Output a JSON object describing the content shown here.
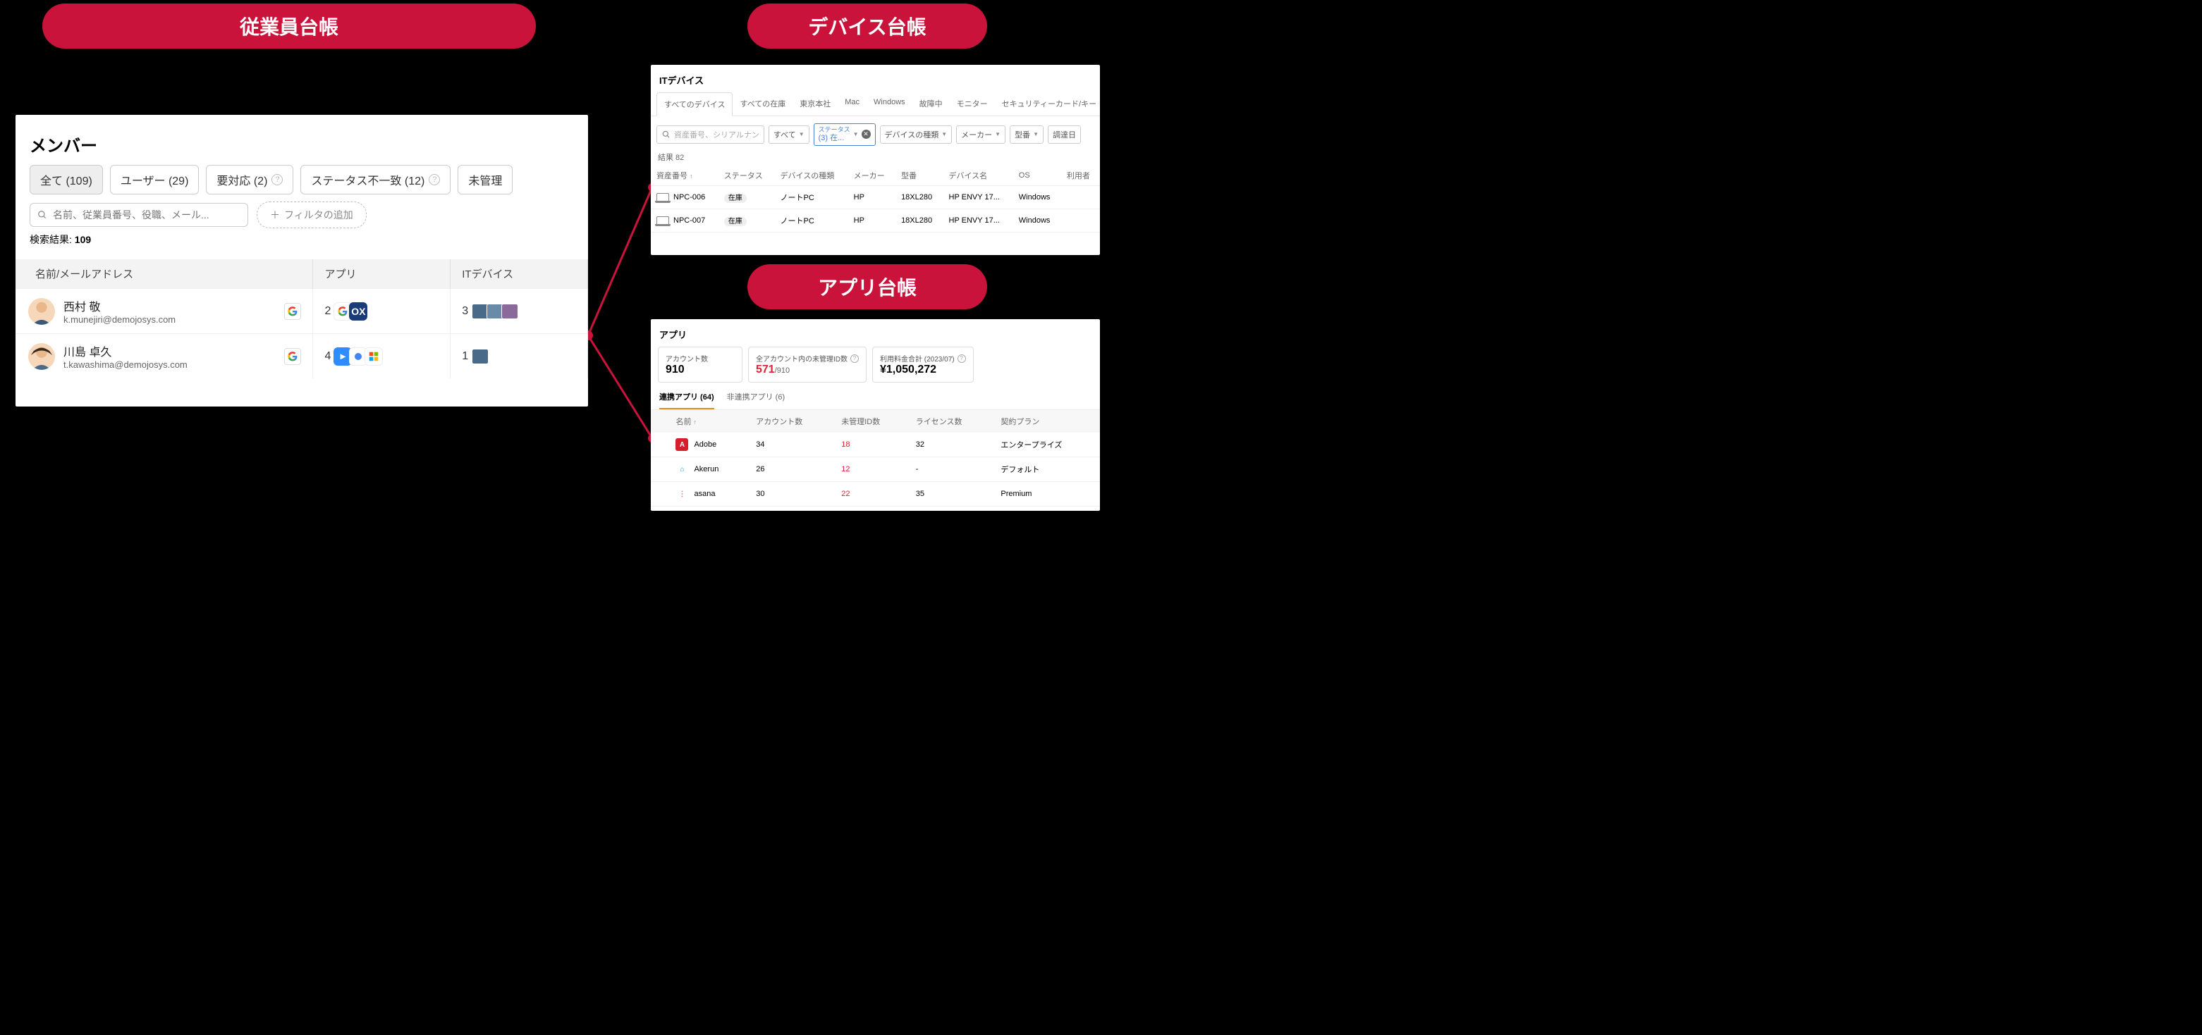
{
  "badges": {
    "employees": "従業員台帳",
    "devices": "デバイス台帳",
    "apps": "アプリ台帳"
  },
  "members": {
    "title": "メンバー",
    "tabs": [
      {
        "label": "全て (109)",
        "active": true
      },
      {
        "label": "ユーザー (29)"
      },
      {
        "label": "要対応 (2)",
        "help": true
      },
      {
        "label": "ステータス不一致 (12)",
        "help": true
      },
      {
        "label": "未管理"
      }
    ],
    "search_placeholder": "名前、従業員番号、役職、メール...",
    "add_filter": "フィルタの追加",
    "result_label": "検索結果: ",
    "result_count": "109",
    "columns": {
      "name": "名前/メールアドレス",
      "app": "アプリ",
      "device": "ITデバイス"
    },
    "rows": [
      {
        "name": "西村 敬",
        "email": "k.munejiri@demojosys.com",
        "app_count": "2",
        "dev_count": "3"
      },
      {
        "name": "川島 卓久",
        "email": "t.kawashima@demojosys.com",
        "app_count": "4",
        "dev_count": "1"
      }
    ]
  },
  "devices": {
    "title": "ITデバイス",
    "tabs": [
      "すべてのデバイス",
      "すべての在庫",
      "東京本社",
      "Mac",
      "Windows",
      "故障中",
      "モニター",
      "セキュリティーカード/キー"
    ],
    "filters": {
      "search_ph": "資産番号、シリアルナン",
      "all": "すべて",
      "status_label": "ステータス",
      "status_val": "(3) 在...",
      "devtype": "デバイスの種類",
      "maker": "メーカー",
      "model": "型番",
      "date": "調達日"
    },
    "result": "結果 82",
    "cols": [
      "資産番号",
      "ステータス",
      "デバイスの種類",
      "メーカー",
      "型番",
      "デバイス名",
      "OS",
      "利用者"
    ],
    "rows": [
      {
        "asset": "NPC-006",
        "status": "在庫",
        "type": "ノートPC",
        "maker": "HP",
        "model": "18XL280",
        "name": "HP ENVY 17...",
        "os": "Windows"
      },
      {
        "asset": "NPC-007",
        "status": "在庫",
        "type": "ノートPC",
        "maker": "HP",
        "model": "18XL280",
        "name": "HP ENVY 17...",
        "os": "Windows"
      }
    ]
  },
  "apps": {
    "title": "アプリ",
    "cards": [
      {
        "label": "アカウント数",
        "value": "910"
      },
      {
        "label": "全アカウント内の未管理ID数",
        "value_red": "571",
        "value_sub": "/910",
        "help": true
      },
      {
        "label": "利用料金合計 (2023/07)",
        "value": "¥1,050,272",
        "help": true
      }
    ],
    "tabs": [
      {
        "label": "連携アプリ (64)",
        "active": true
      },
      {
        "label": "非連携アプリ (6)"
      }
    ],
    "cols": [
      "名前",
      "アカウント数",
      "未管理ID数",
      "ライセンス数",
      "契約プラン"
    ],
    "rows": [
      {
        "name": "Adobe",
        "logo_bg": "#d71e2b",
        "logo_fg": "#fff",
        "logo_txt": "A",
        "acc": "34",
        "unm": "18",
        "lic": "32",
        "plan": "エンタープライズ"
      },
      {
        "name": "Akerun",
        "logo_bg": "#fff",
        "logo_fg": "#1aa8c4",
        "logo_txt": "⌂",
        "acc": "26",
        "unm": "12",
        "lic": "-",
        "plan": "デフォルト"
      },
      {
        "name": "asana",
        "logo_bg": "#fff",
        "logo_fg": "#f06a6a",
        "logo_txt": "⋮",
        "acc": "30",
        "unm": "22",
        "lic": "35",
        "plan": "Premium"
      }
    ]
  }
}
